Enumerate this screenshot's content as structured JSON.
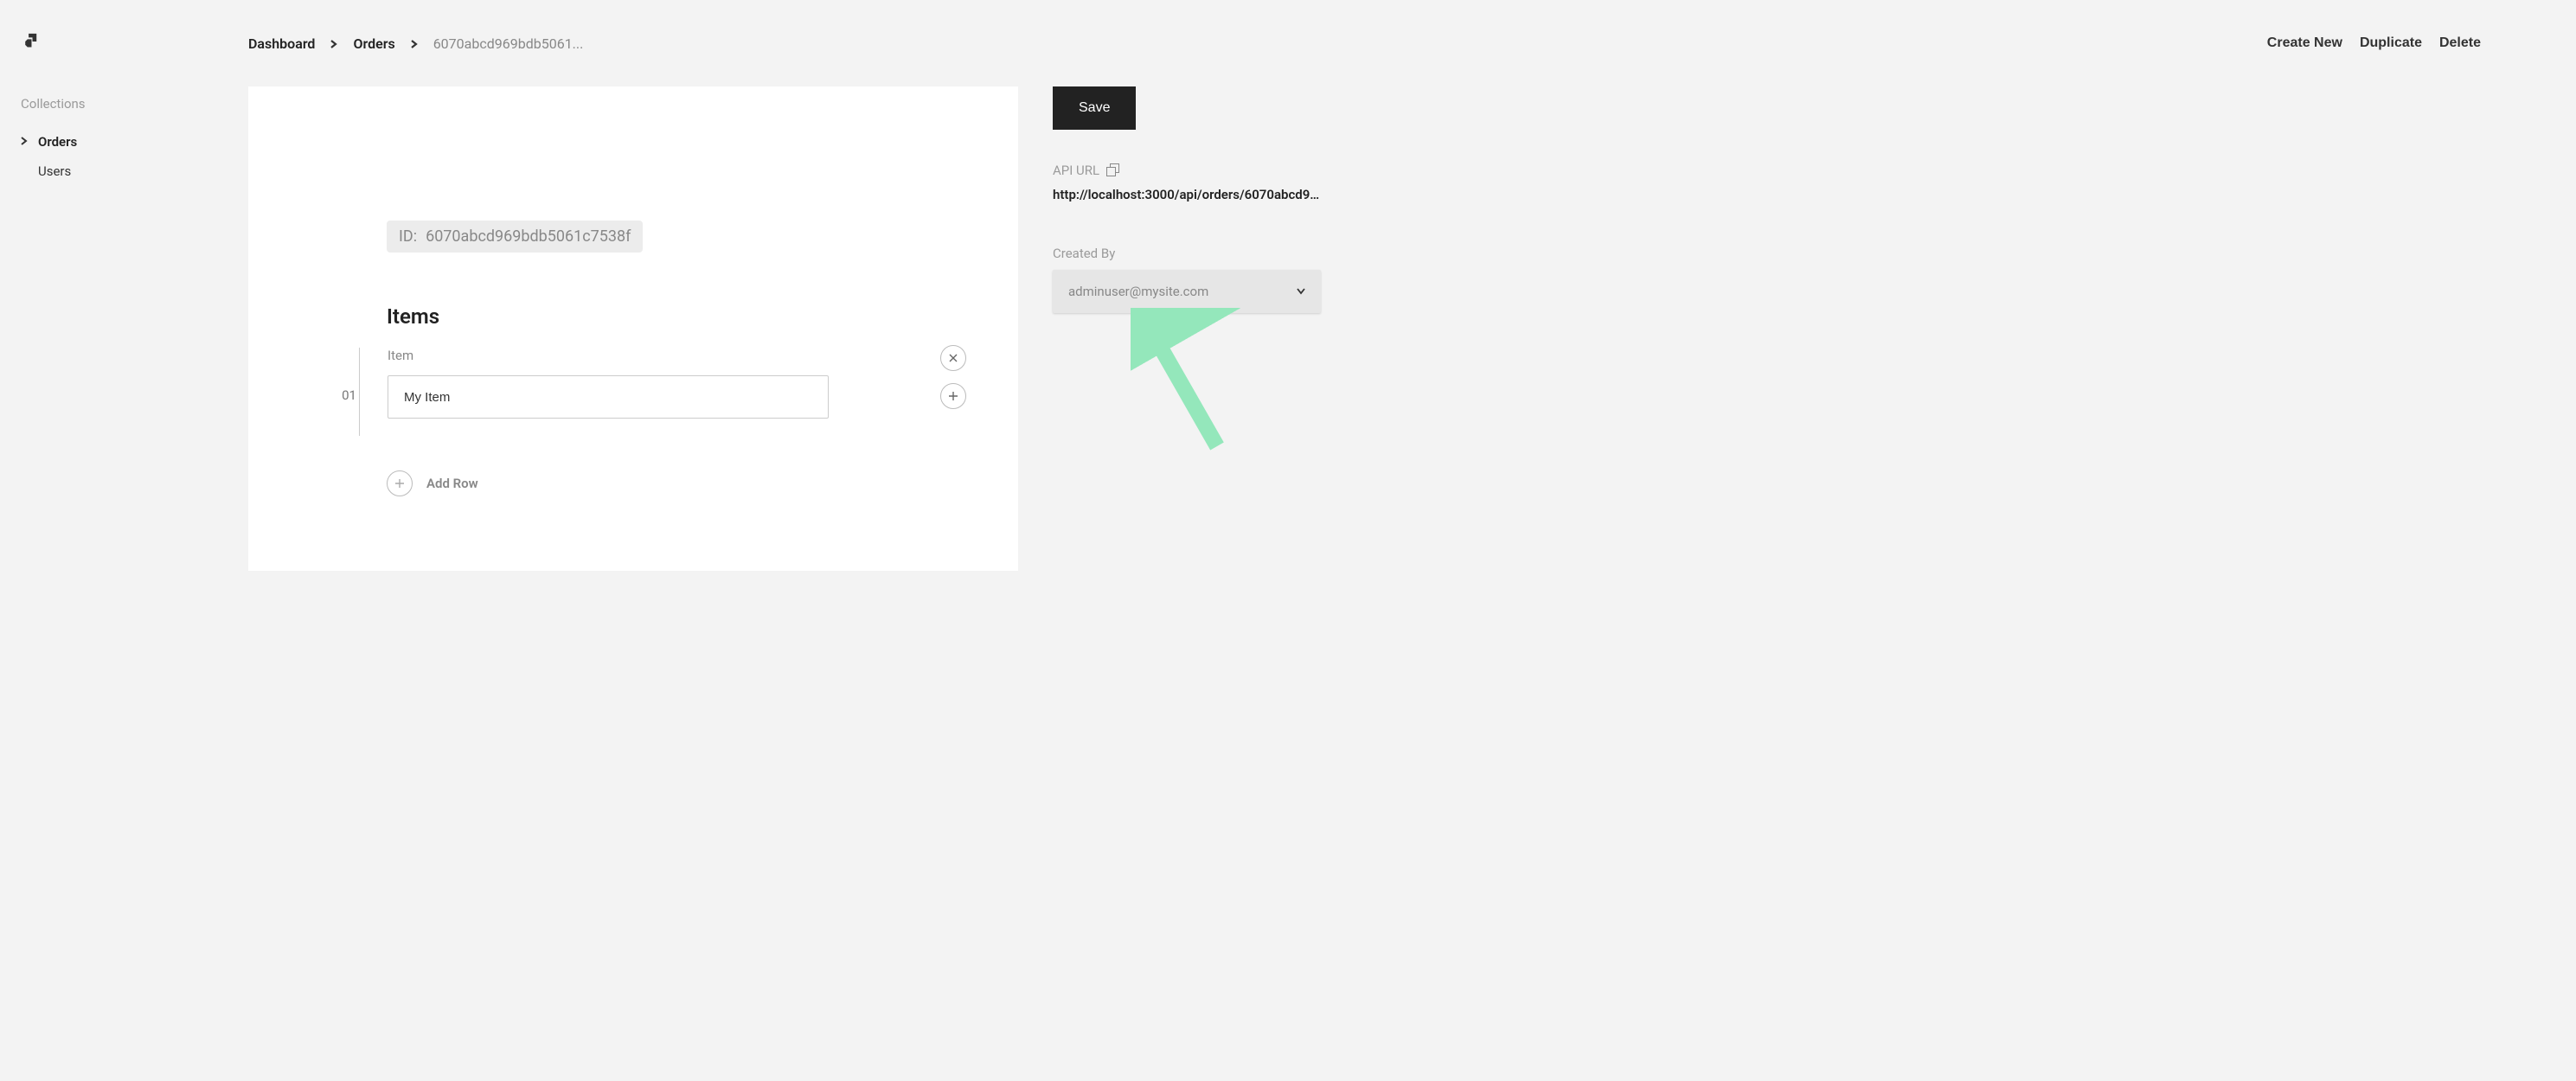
{
  "sidebar": {
    "heading": "Collections",
    "items": [
      {
        "label": "Orders",
        "active": true
      },
      {
        "label": "Users",
        "active": false
      }
    ]
  },
  "breadcrumb": {
    "dashboard": "Dashboard",
    "collection": "Orders",
    "current": "6070abcd969bdb5061..."
  },
  "topActions": {
    "createNew": "Create New",
    "duplicate": "Duplicate",
    "delete": "Delete"
  },
  "editor": {
    "idLabel": "ID:",
    "idValue": "6070abcd969bdb5061c7538f",
    "sectionTitle": "Items",
    "item": {
      "index": "01",
      "label": "Item",
      "value": "My Item"
    },
    "addRow": "Add Row"
  },
  "rightPanel": {
    "saveLabel": "Save",
    "apiUrlLabel": "API URL",
    "apiUrlValue": "http://localhost:3000/api/orders/6070abcd96...",
    "createdByLabel": "Created By",
    "createdByValue": "adminuser@mysite.com"
  }
}
